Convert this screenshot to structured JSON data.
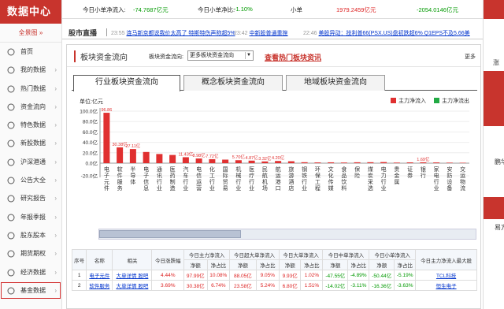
{
  "sidebar": {
    "title": "数据中心",
    "all_label": "全景图",
    "items": [
      {
        "label": "首页",
        "icon": "home-icon"
      },
      {
        "label": "我的数据",
        "icon": "user-icon"
      },
      {
        "label": "热门数据",
        "icon": "fire-icon"
      },
      {
        "label": "资金流向",
        "icon": "flow-icon"
      },
      {
        "label": "特色数据",
        "icon": "star-icon"
      },
      {
        "label": "新股数据",
        "icon": "new-icon"
      },
      {
        "label": "沪深港通",
        "icon": "connect-icon"
      },
      {
        "label": "公告大全",
        "icon": "notice-icon"
      },
      {
        "label": "研究报告",
        "icon": "report-icon"
      },
      {
        "label": "年报季报",
        "icon": "annual-icon"
      },
      {
        "label": "股东股本",
        "icon": "holder-icon"
      },
      {
        "label": "期货期权",
        "icon": "futures-icon"
      },
      {
        "label": "经济数据",
        "icon": "economy-icon"
      },
      {
        "label": "基金数据",
        "icon": "fund-icon"
      }
    ]
  },
  "topline": {
    "small_in_label": "今日小单净流入:",
    "small_in_value": "-74.7687亿元",
    "small_ratio_label": "今日小单净比:",
    "small_ratio_value": "-1.10%",
    "small_type": "小单",
    "small_v1": "1979.2459亿元",
    "small_v2": "-2054.0146亿元"
  },
  "ticker": {
    "label": "股市直播",
    "news": [
      {
        "time": "23:55",
        "text": "连马新京都说我价太高了 特斯特伤声称超5%",
        "color": "#0033cc"
      },
      {
        "time": "23:42",
        "text": "中新股普通重挫",
        "color": "#0033cc"
      },
      {
        "time": "22:46",
        "text": "美股异动：技利普66(PSX.US)盘初跌超6% Q1EPS不及5.66美",
        "color": "#0033cc"
      }
    ]
  },
  "panel": {
    "title": "板块资金流向",
    "select_label": "板块资金流向:",
    "select_value": "更多板块资金流向",
    "hot_link": "查看热门板块资讯",
    "more": "更多",
    "tabs": [
      "行业板块资金流向",
      "概念板块资金流向",
      "地域板块资金流向"
    ]
  },
  "chart_data": {
    "type": "bar",
    "unit_label": "单位:亿元",
    "ylim": [
      -20,
      100
    ],
    "yticks": [
      "100.0亿",
      "80.0亿",
      "60.0亿",
      "40.0亿",
      "20.0亿",
      "0.0亿",
      "-20.0亿"
    ],
    "legend": [
      {
        "name": "主力净流入",
        "color": "#e03030"
      },
      {
        "name": "主力净流出",
        "color": "#22aa44"
      }
    ],
    "categories": [
      "电子元件",
      "软件服务",
      "半导体",
      "电子信息",
      "通讯行业",
      "医药制造",
      "汽车行业",
      "电信运营",
      "化工行业",
      "国际贸易",
      "机械行业",
      "医疗行业",
      "民航机场",
      "航运港口",
      "旅游酒店",
      "钢铁行业",
      "环保工程",
      "文化传媒",
      "食品饮料",
      "保险",
      "煤炭采选",
      "电力行业",
      "贵金属",
      "证券",
      "银行",
      "家电行业",
      "安防设备",
      "交运物流"
    ],
    "values": [
      96.86,
      30.38,
      27.11,
      21.5,
      17.6,
      15.8,
      11.43,
      8.98,
      7.72,
      6.8,
      5.7,
      4.87,
      3.32,
      4.2,
      3.7,
      1.8,
      1.4,
      1.6,
      1.2,
      1.7,
      1.8,
      2.1,
      1.1,
      1.5,
      1.69,
      1.4,
      1.0,
      0.8
    ],
    "data_labels": [
      "96.86",
      "30.38亿",
      "27.11亿",
      "",
      "",
      "",
      "11.43亿",
      "8.98亿",
      "7.72亿",
      "",
      "5.70亿",
      "4.87亿",
      "3.32亿",
      "4.20亿",
      "",
      "",
      "",
      "",
      "",
      "",
      "",
      "",
      "",
      "",
      "1.69亿",
      "",
      "",
      ""
    ]
  },
  "table": {
    "headers_top": [
      "序号",
      "名称",
      "相关",
      "今日涨跌幅",
      "今日主力净流入",
      "今日超大单净流入",
      "今日大单净流入",
      "今日中单净流入",
      "今日小单净流入",
      "今日主力净流入最大股"
    ],
    "headers_sub": [
      "净额",
      "净占比",
      "净额",
      "净占比",
      "净额",
      "净占比",
      "净额",
      "净占比",
      "净额",
      "净占比"
    ],
    "rows": [
      {
        "no": "1",
        "name": "电子元件",
        "related": "大单详情 股吧",
        "chg": "4.44%",
        "c1": "97.99亿",
        "c2": "10.08%",
        "c3": "88.05亿",
        "c4": "9.05%",
        "c5": "9.93亿",
        "c6": "1.02%",
        "c7": "-47.55亿",
        "c8": "-4.89%",
        "c9": "-50.44亿",
        "c10": "-5.19%",
        "top": "TCL科技"
      },
      {
        "no": "2",
        "name": "软件服务",
        "related": "大单详情 股吧",
        "chg": "3.69%",
        "c1": "30.38亿",
        "c2": "6.74%",
        "c3": "23.58亿",
        "c4": "5.24%",
        "c5": "6.80亿",
        "c6": "1.51%",
        "c7": "-14.02亿",
        "c8": "-3.11%",
        "c9": "-16.36亿",
        "c10": "-3.63%",
        "top": "恒生电子"
      }
    ]
  },
  "right": {
    "t1": "涨",
    "t2": "鹏华",
    "t3": "易方"
  }
}
